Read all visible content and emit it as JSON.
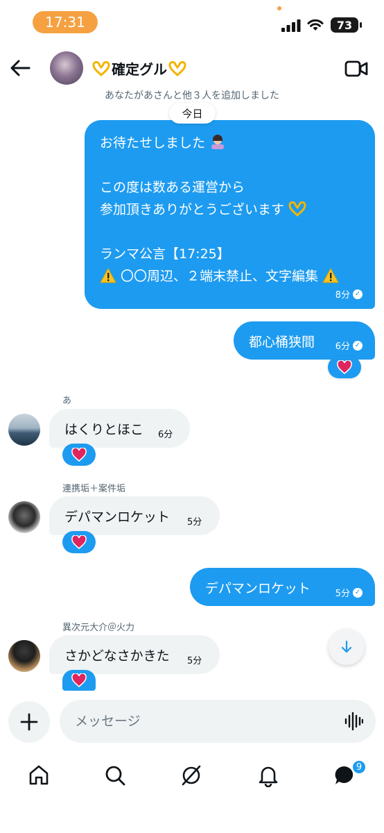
{
  "status_bar": {
    "time": "17:31",
    "battery": "73"
  },
  "header": {
    "title": "確定グル"
  },
  "system_message": "あなたがあさんと他３人を追加しました",
  "date_divider": "今日",
  "messages": [
    {
      "direction": "outgoing",
      "lines": [
        "お待たせしました",
        "",
        "この度は数ある運営から",
        "参加頂きありがとうございます",
        "",
        "ランマ公言【17:25】",
        "〇〇周辺、２端末禁止、文字編集"
      ],
      "time": "8分"
    },
    {
      "direction": "outgoing",
      "text": "都心桶狭間",
      "time": "6分",
      "reaction": "heart"
    },
    {
      "direction": "incoming",
      "sender": "あ",
      "text": "はくりとほこ",
      "time": "6分",
      "reaction": "heart"
    },
    {
      "direction": "incoming",
      "sender": "連携垢＋案件垢",
      "text": "デパマンロケット",
      "time": "5分",
      "reaction": "heart"
    },
    {
      "direction": "outgoing",
      "text": "デパマンロケット",
      "time": "5分"
    },
    {
      "direction": "incoming",
      "sender": "異次元大介＠火力",
      "text": "さかどなさかきた",
      "time": "5分",
      "reaction": "heart"
    }
  ],
  "composer": {
    "placeholder": "メッセージ"
  },
  "nav": {
    "items": [
      "home-icon",
      "search-icon",
      "grok-icon",
      "notifications-icon",
      "messages-icon"
    ],
    "messages_badge": "9"
  },
  "colors": {
    "accent": "#1d9bf0",
    "incoming_bubble": "#eff3f4",
    "status_pill": "#f5a142",
    "heart": "#e0245e"
  }
}
